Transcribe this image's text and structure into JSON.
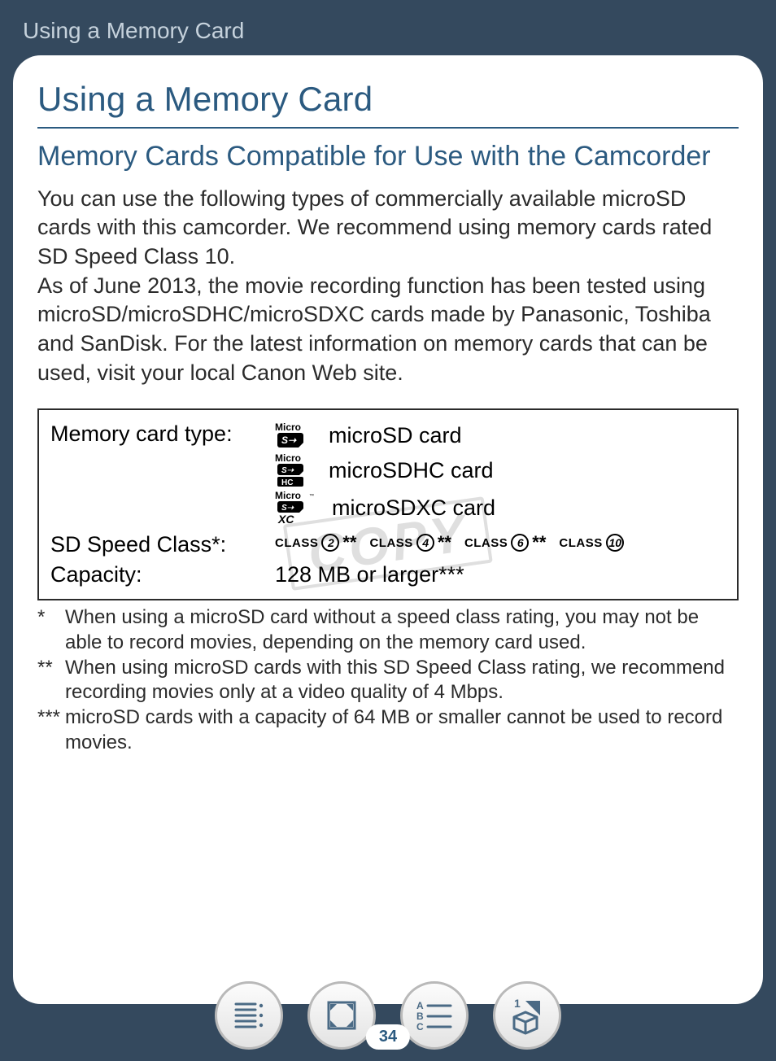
{
  "header": {
    "breadcrumb": "Using a Memory Card"
  },
  "page": {
    "title": "Using a Memory Card",
    "subtitle": "Memory Cards Compatible for Use with the Camcorder",
    "intro": "You can use the following types of commercially available microSD cards with this camcorder. We recommend using memory cards rated SD Speed Class 10.\nAs of June 2013, the movie recording function has been tested using microSD/microSDHC/microSDXC cards made by Panasonic, Toshiba and SanDisk. For the latest information on memory cards that can be used, visit your local Canon Web site.",
    "watermark": "COPY"
  },
  "spec": {
    "type_label": "Memory card type:",
    "types": [
      {
        "logo": "microsd",
        "text": "microSD card"
      },
      {
        "logo": "microsdhc",
        "text": "microSDHC card"
      },
      {
        "logo": "microsdxc",
        "text": "microSDXC card"
      }
    ],
    "speed_label": "SD Speed Class*:",
    "speeds": [
      {
        "class": "2",
        "suffix": "**"
      },
      {
        "class": "4",
        "suffix": "**"
      },
      {
        "class": "6",
        "suffix": "**"
      },
      {
        "class": "10",
        "suffix": ""
      }
    ],
    "capacity_label": "Capacity:",
    "capacity_value": "128 MB or larger***"
  },
  "notes": [
    {
      "mark": "*",
      "text": "When using a microSD card without a speed class rating, you may not be able to record movies, depending on the memory card used."
    },
    {
      "mark": "**",
      "text": "When using microSD cards with this SD Speed Class rating, we recommend recording movies only at a video quality of 4 Mbps."
    },
    {
      "mark": "***",
      "text": "microSD cards with a capacity of 64 MB or smaller cannot be used to record movies."
    }
  ],
  "footer": {
    "page_number": "34",
    "buttons": [
      "toc",
      "expand",
      "abc",
      "out"
    ]
  }
}
